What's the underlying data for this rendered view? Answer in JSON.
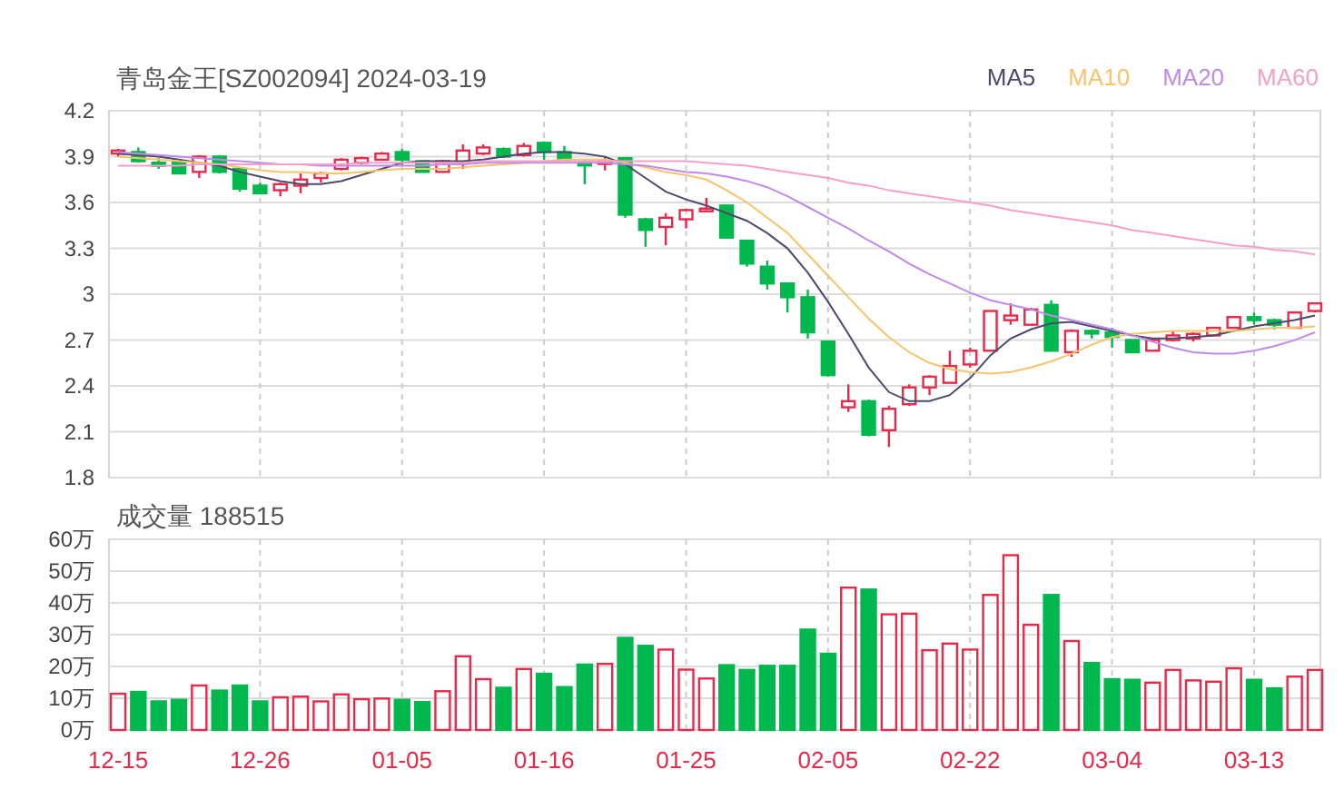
{
  "price_chart": {
    "title": "青岛金王[SZ002094] 2024-03-19",
    "chart_data": {
      "type": "candlestick",
      "grid": true,
      "categories": [
        null,
        null,
        null,
        null,
        null,
        null,
        null,
        null,
        null,
        null,
        null,
        null,
        null,
        null,
        null,
        null,
        null,
        null,
        null,
        null,
        null,
        null,
        null,
        null,
        null,
        null,
        null,
        null,
        null,
        null,
        null,
        null,
        null,
        null,
        null,
        null,
        null,
        null,
        null,
        null,
        null,
        null,
        null,
        null,
        null,
        null,
        null,
        null,
        null,
        null,
        null,
        null,
        null,
        null,
        null,
        null,
        null,
        null,
        null,
        null
      ],
      "ylim": [
        1.8,
        4.2
      ],
      "yticks": [
        {
          "value": 1.8,
          "label": "1.8"
        },
        {
          "value": 2.1,
          "label": "2.1"
        },
        {
          "value": 2.4,
          "label": "2.4"
        },
        {
          "value": 2.7,
          "label": "2.7"
        },
        {
          "value": 3,
          "label": "3"
        },
        {
          "value": 3.3,
          "label": "3.3"
        },
        {
          "value": 3.6,
          "label": "3.6"
        },
        {
          "value": 3.9,
          "label": "3.9"
        },
        {
          "value": 4.2,
          "label": "4.2"
        }
      ],
      "ohlc": [
        [
          3.92,
          3.95,
          3.9,
          3.94
        ],
        [
          3.93,
          3.96,
          3.86,
          3.87
        ],
        [
          3.86,
          3.89,
          3.82,
          3.84
        ],
        [
          3.86,
          3.86,
          3.79,
          3.79
        ],
        [
          3.8,
          3.91,
          3.76,
          3.9
        ],
        [
          3.9,
          3.91,
          3.79,
          3.8
        ],
        [
          3.82,
          3.82,
          3.67,
          3.69
        ],
        [
          3.71,
          3.73,
          3.66,
          3.66
        ],
        [
          3.68,
          3.73,
          3.64,
          3.72
        ],
        [
          3.71,
          3.79,
          3.66,
          3.75
        ],
        [
          3.76,
          3.8,
          3.73,
          3.79
        ],
        [
          3.82,
          3.89,
          3.81,
          3.88
        ],
        [
          3.86,
          3.9,
          3.85,
          3.89
        ],
        [
          3.88,
          3.93,
          3.88,
          3.92
        ],
        [
          3.93,
          3.95,
          3.84,
          3.88
        ],
        [
          3.87,
          3.87,
          3.8,
          3.8
        ],
        [
          3.8,
          3.88,
          3.8,
          3.87
        ],
        [
          3.86,
          3.98,
          3.82,
          3.94
        ],
        [
          3.92,
          3.98,
          3.91,
          3.96
        ],
        [
          3.95,
          3.96,
          3.89,
          3.9
        ],
        [
          3.91,
          3.99,
          3.9,
          3.97
        ],
        [
          3.99,
          4.0,
          3.88,
          3.93
        ],
        [
          3.93,
          3.97,
          3.87,
          3.88
        ],
        [
          3.86,
          3.88,
          3.72,
          3.85
        ],
        [
          3.86,
          3.9,
          3.81,
          3.87
        ],
        [
          3.89,
          3.89,
          3.5,
          3.52
        ],
        [
          3.49,
          3.5,
          3.31,
          3.42
        ],
        [
          3.44,
          3.53,
          3.32,
          3.5
        ],
        [
          3.49,
          3.56,
          3.43,
          3.55
        ],
        [
          3.55,
          3.63,
          3.54,
          3.56
        ],
        [
          3.58,
          3.58,
          3.37,
          3.37
        ],
        [
          3.35,
          3.35,
          3.18,
          3.2
        ],
        [
          3.18,
          3.22,
          3.03,
          3.07
        ],
        [
          3.07,
          3.07,
          2.88,
          2.98
        ],
        [
          2.98,
          3.03,
          2.71,
          2.75
        ],
        [
          2.69,
          2.69,
          2.47,
          2.47
        ],
        [
          2.26,
          2.41,
          2.23,
          2.3
        ],
        [
          2.3,
          2.31,
          2.07,
          2.08
        ],
        [
          2.11,
          2.27,
          2.0,
          2.25
        ],
        [
          2.28,
          2.41,
          2.27,
          2.39
        ],
        [
          2.39,
          2.47,
          2.34,
          2.46
        ],
        [
          2.42,
          2.63,
          2.42,
          2.53
        ],
        [
          2.54,
          2.65,
          2.52,
          2.63
        ],
        [
          2.63,
          2.89,
          2.63,
          2.89
        ],
        [
          2.83,
          2.94,
          2.8,
          2.86
        ],
        [
          2.8,
          2.91,
          2.8,
          2.9
        ],
        [
          2.93,
          2.96,
          2.63,
          2.63
        ],
        [
          2.62,
          2.77,
          2.59,
          2.76
        ],
        [
          2.76,
          2.77,
          2.71,
          2.75
        ],
        [
          2.75,
          2.78,
          2.65,
          2.72
        ],
        [
          2.7,
          2.7,
          2.62,
          2.62
        ],
        [
          2.63,
          2.71,
          2.63,
          2.7
        ],
        [
          2.7,
          2.76,
          2.69,
          2.73
        ],
        [
          2.71,
          2.75,
          2.69,
          2.74
        ],
        [
          2.73,
          2.78,
          2.73,
          2.78
        ],
        [
          2.78,
          2.85,
          2.78,
          2.85
        ],
        [
          2.85,
          2.88,
          2.8,
          2.83
        ],
        [
          2.83,
          2.84,
          2.77,
          2.8
        ],
        [
          2.78,
          2.88,
          2.78,
          2.88
        ],
        [
          2.89,
          2.94,
          2.88,
          2.94
        ]
      ],
      "series": [
        {
          "type": "line",
          "name": "MA5",
          "color": "#4b4a6b",
          "values": [
            3.92,
            3.91,
            3.9,
            3.88,
            3.86,
            3.84,
            3.8,
            3.77,
            3.74,
            3.72,
            3.72,
            3.74,
            3.78,
            3.82,
            3.86,
            3.87,
            3.87,
            3.87,
            3.88,
            3.9,
            3.92,
            3.93,
            3.93,
            3.92,
            3.9,
            3.85,
            3.76,
            3.67,
            3.62,
            3.58,
            3.53,
            3.48,
            3.4,
            3.3,
            3.14,
            2.95,
            2.74,
            2.52,
            2.36,
            2.3,
            2.3,
            2.34,
            2.45,
            2.6,
            2.71,
            2.77,
            2.81,
            2.82,
            2.79,
            2.76,
            2.73,
            2.71,
            2.71,
            2.72,
            2.73,
            2.76,
            2.79,
            2.81,
            2.83,
            2.86
          ]
        },
        {
          "type": "line",
          "name": "MA10",
          "color": "#f8c36a",
          "values": [
            3.9,
            3.89,
            3.88,
            3.87,
            3.86,
            3.85,
            3.83,
            3.81,
            3.8,
            3.8,
            3.79,
            3.79,
            3.8,
            3.81,
            3.82,
            3.82,
            3.82,
            3.83,
            3.84,
            3.85,
            3.86,
            3.87,
            3.88,
            3.88,
            3.88,
            3.86,
            3.83,
            3.8,
            3.78,
            3.75,
            3.68,
            3.6,
            3.5,
            3.4,
            3.26,
            3.12,
            2.98,
            2.84,
            2.72,
            2.62,
            2.55,
            2.51,
            2.49,
            2.48,
            2.49,
            2.52,
            2.56,
            2.61,
            2.67,
            2.72,
            2.74,
            2.75,
            2.76,
            2.76,
            2.76,
            2.76,
            2.77,
            2.78,
            2.78,
            2.79
          ]
        },
        {
          "type": "line",
          "name": "MA20",
          "color": "#c08ae8",
          "values": [
            3.93,
            3.92,
            3.91,
            3.9,
            3.89,
            3.88,
            3.87,
            3.86,
            3.85,
            3.85,
            3.84,
            3.84,
            3.84,
            3.84,
            3.84,
            3.84,
            3.85,
            3.85,
            3.86,
            3.86,
            3.86,
            3.86,
            3.86,
            3.86,
            3.86,
            3.85,
            3.84,
            3.82,
            3.8,
            3.79,
            3.77,
            3.74,
            3.7,
            3.64,
            3.57,
            3.5,
            3.43,
            3.35,
            3.28,
            3.2,
            3.13,
            3.07,
            3.01,
            2.96,
            2.93,
            2.9,
            2.86,
            2.83,
            2.8,
            2.77,
            2.73,
            2.69,
            2.65,
            2.62,
            2.61,
            2.61,
            2.63,
            2.66,
            2.7,
            2.75
          ]
        },
        {
          "type": "line",
          "name": "MA60",
          "color": "#f5a0c8",
          "values": [
            3.84,
            3.84,
            3.84,
            3.84,
            3.85,
            3.85,
            3.85,
            3.85,
            3.85,
            3.85,
            3.85,
            3.85,
            3.86,
            3.86,
            3.86,
            3.86,
            3.86,
            3.86,
            3.87,
            3.87,
            3.87,
            3.87,
            3.87,
            3.87,
            3.87,
            3.87,
            3.87,
            3.87,
            3.87,
            3.86,
            3.85,
            3.84,
            3.82,
            3.8,
            3.78,
            3.76,
            3.73,
            3.71,
            3.68,
            3.66,
            3.64,
            3.62,
            3.6,
            3.58,
            3.55,
            3.53,
            3.51,
            3.49,
            3.47,
            3.45,
            3.42,
            3.4,
            3.38,
            3.36,
            3.34,
            3.32,
            3.31,
            3.29,
            3.28,
            3.26
          ]
        }
      ]
    }
  },
  "volume_chart": {
    "title": "成交量 188515",
    "chart_data": {
      "type": "bar",
      "grid": true,
      "categories": [
        "12-15",
        null,
        null,
        null,
        null,
        null,
        null,
        "12-26",
        null,
        null,
        null,
        null,
        null,
        null,
        "01-05",
        null,
        null,
        null,
        null,
        null,
        null,
        "01-16",
        null,
        null,
        null,
        null,
        null,
        null,
        "01-25",
        null,
        null,
        null,
        null,
        null,
        null,
        "02-05",
        null,
        null,
        null,
        null,
        null,
        null,
        "02-22",
        null,
        null,
        null,
        null,
        null,
        null,
        "03-04",
        null,
        null,
        null,
        null,
        null,
        null,
        "03-13",
        null,
        null,
        null
      ],
      "ylim": [
        0,
        60
      ],
      "yticks": [
        {
          "value": 0,
          "label": "0万"
        },
        {
          "value": 10,
          "label": "10万"
        },
        {
          "value": 20,
          "label": "20万"
        },
        {
          "value": 30,
          "label": "30万"
        },
        {
          "value": 40,
          "label": "40万"
        },
        {
          "value": 50,
          "label": "50万"
        },
        {
          "value": 60,
          "label": "60万"
        }
      ],
      "series": [
        {
          "values": [
            11.4,
            12,
            9,
            9.5,
            14,
            12.4,
            14,
            9,
            10.3,
            10.5,
            9,
            11.2,
            9.7,
            9.9,
            9.5,
            8.8,
            12.2,
            23.2,
            16,
            13.3,
            19.2,
            17.7,
            13.5,
            20.6,
            20.8,
            29,
            26.5,
            25.3,
            19,
            16.2,
            20.4,
            18.9,
            20.2,
            20.2,
            31.6,
            24,
            44.8,
            44.2,
            36.4,
            36.6,
            25.1,
            27.2,
            25.3,
            42.5,
            55,
            33.1,
            42.5,
            28,
            21.1,
            16,
            15.8,
            14.9,
            18.9,
            15.6,
            15.2,
            19.4,
            15.8,
            13.1,
            16.8,
            18.9
          ]
        }
      ]
    }
  }
}
